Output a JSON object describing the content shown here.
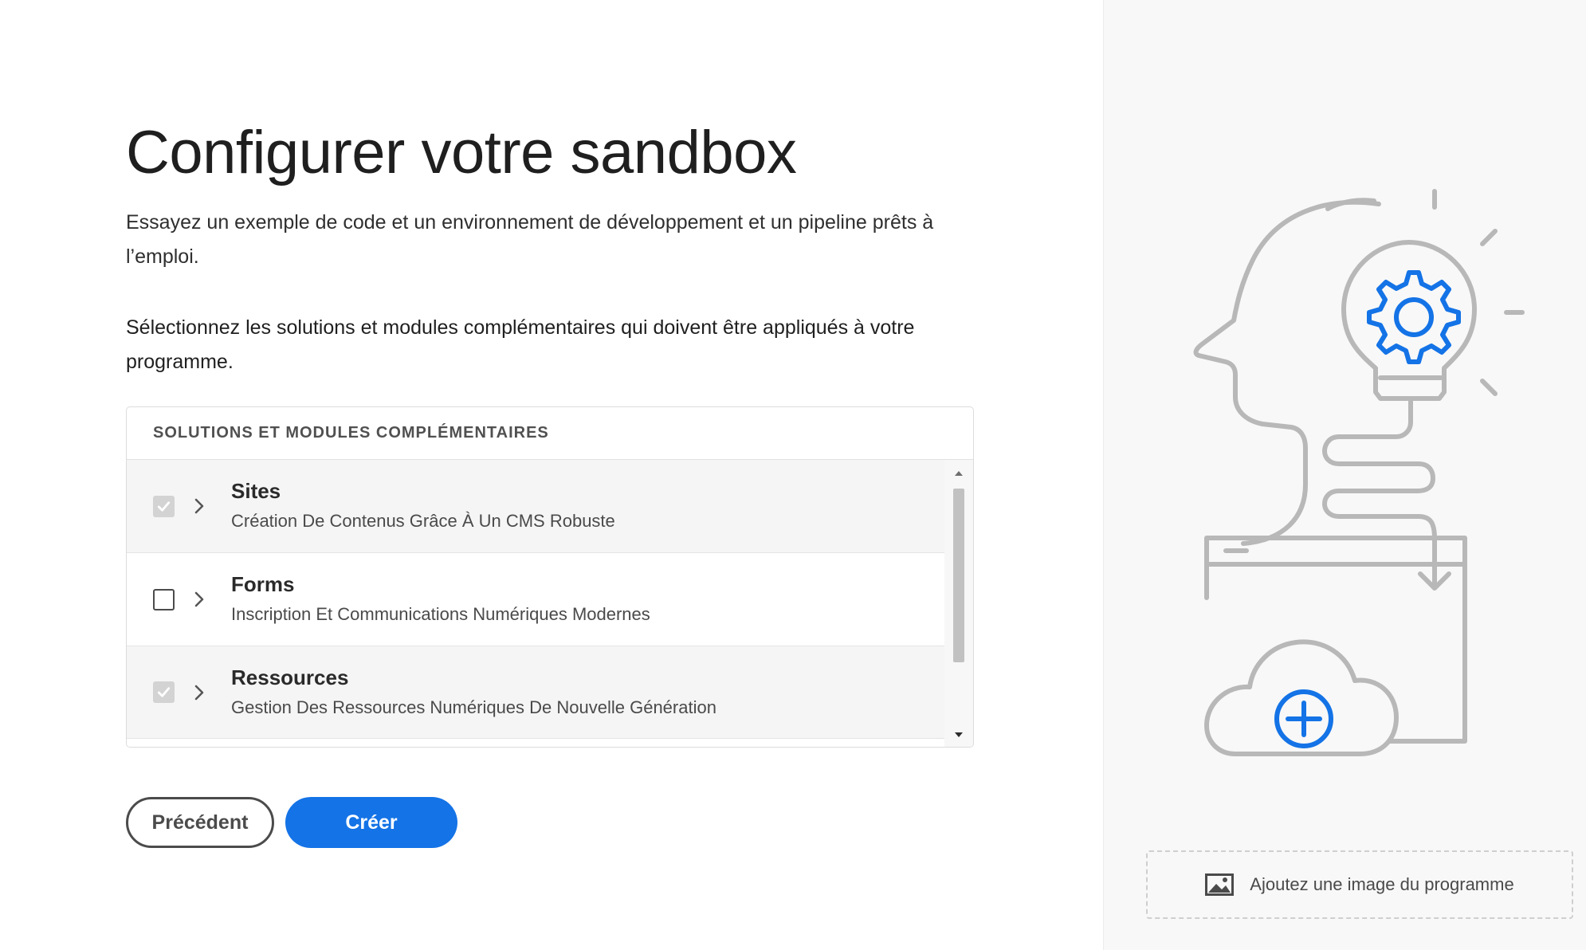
{
  "page": {
    "title": "Configurer votre sandbox",
    "description": "Essayez un exemple de code et un environnement de développement et un pipeline prêts à l’emploi.",
    "instructions": "Sélectionnez les solutions et modules complémentaires qui doivent être appliqués à votre programme."
  },
  "panel": {
    "header": "SOLUTIONS ET MODULES COMPLÉMENTAIRES",
    "items": [
      {
        "title": "Sites",
        "subtitle": "Création De Contenus Grâce À Un CMS Robuste",
        "checked": true
      },
      {
        "title": "Forms",
        "subtitle": "Inscription Et Communications Numériques Modernes",
        "checked": false
      },
      {
        "title": "Ressources",
        "subtitle": "Gestion Des Ressources Numériques De Nouvelle Génération",
        "checked": true
      }
    ]
  },
  "buttons": {
    "back": "Précédent",
    "create": "Créer"
  },
  "side": {
    "add_image": "Ajoutez une image du programme"
  },
  "icons": {
    "checkbox": "checkmark-icon",
    "expand": "chevron-right-icon",
    "scroll_up": "triangle-up-icon",
    "scroll_down": "triangle-down-icon",
    "image": "image-icon",
    "illustration": "head-lightbulb-cloud-illustration"
  },
  "colors": {
    "accent": "#1473e6",
    "illustration_stroke": "#b8b8b8"
  }
}
